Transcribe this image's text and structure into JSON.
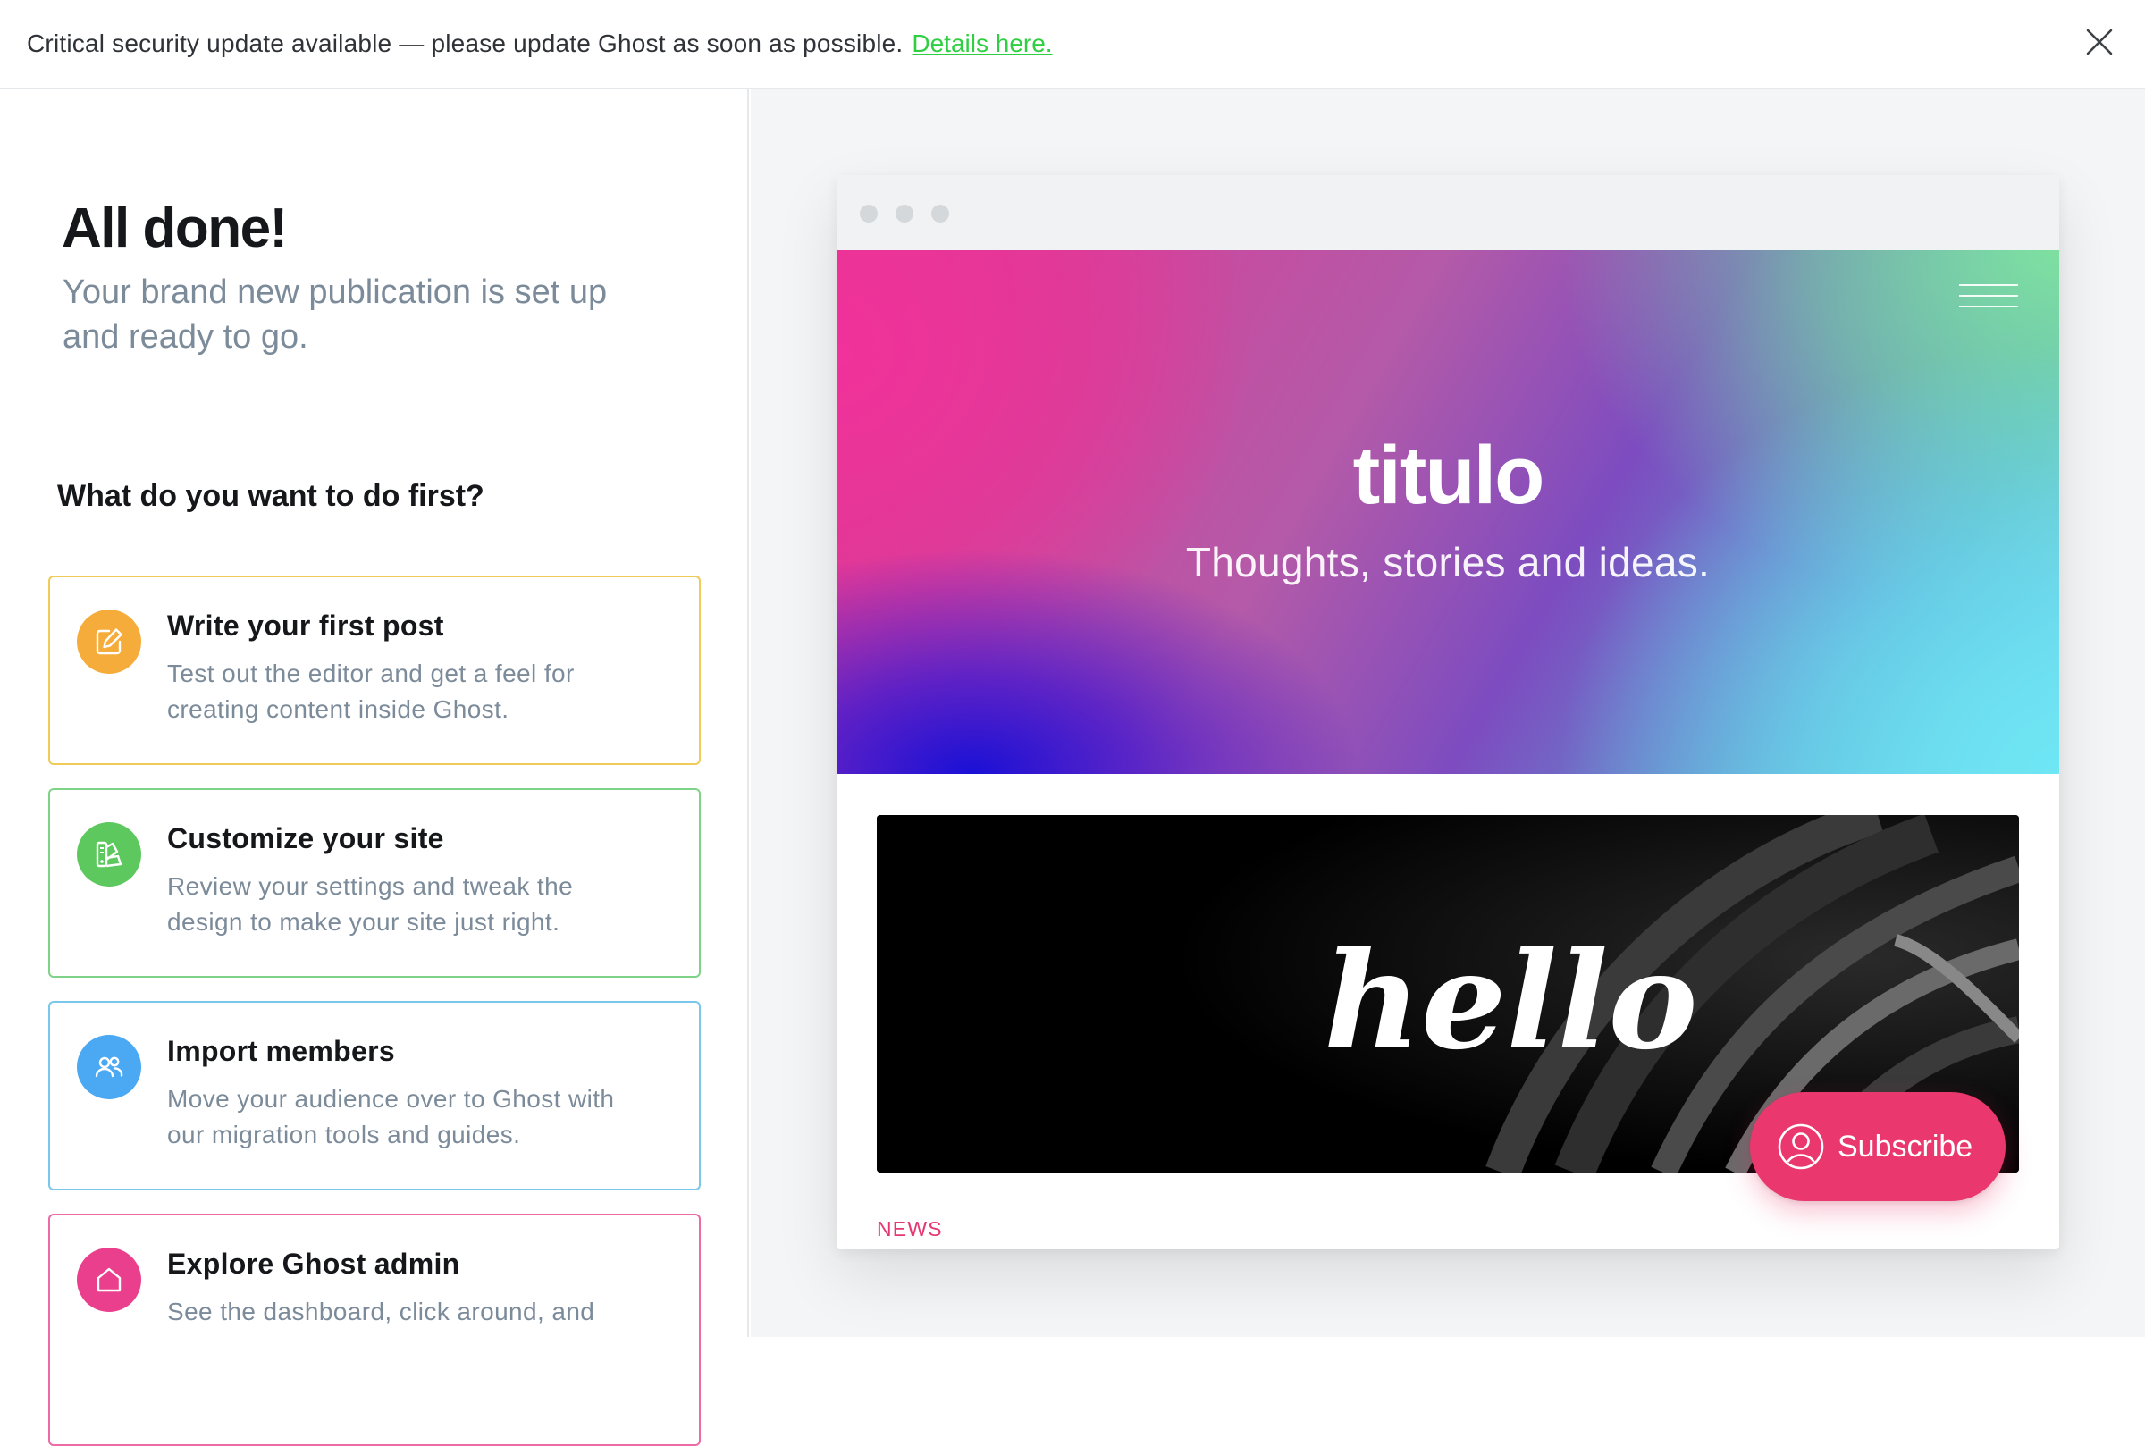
{
  "banner": {
    "message": "Critical security update available — please update Ghost as soon as possible.",
    "link_label": "Details here."
  },
  "onboarding": {
    "title": "All done!",
    "subtitle": "Your brand new publication is set up and ready to go.",
    "question": "What do you want to do first?",
    "cards": [
      {
        "title": "Write your first post",
        "description": "Test out the editor and get a feel for creating content inside Ghost.",
        "icon": "pencil-edit-icon",
        "color": "#f5ac3a"
      },
      {
        "title": "Customize your site",
        "description": "Review your settings and tweak the design to make your site just right.",
        "icon": "paint-palette-icon",
        "color": "#5dc85e"
      },
      {
        "title": "Import members",
        "description": "Move your audience over to Ghost with our migration tools and guides.",
        "icon": "members-icon",
        "color": "#4ba8f2"
      },
      {
        "title": "Explore Ghost admin",
        "description": "See the dashboard, click around, and",
        "icon": "home-icon",
        "color": "#ea3f8c"
      }
    ]
  },
  "preview": {
    "site_title": "titulo",
    "site_description": "Thoughts, stories and ideas.",
    "feature_image_text": "hello",
    "post_tag": "NEWS",
    "subscribe_label": "Subscribe"
  },
  "colors": {
    "accent": "#ea386e",
    "link_green": "#30cf43",
    "muted_text": "#7c8b9a",
    "card_border_yellow": "#f0cb5a",
    "card_border_green": "#7fd389",
    "card_border_blue": "#79c8eb",
    "card_border_pink": "#ec6aa6"
  }
}
